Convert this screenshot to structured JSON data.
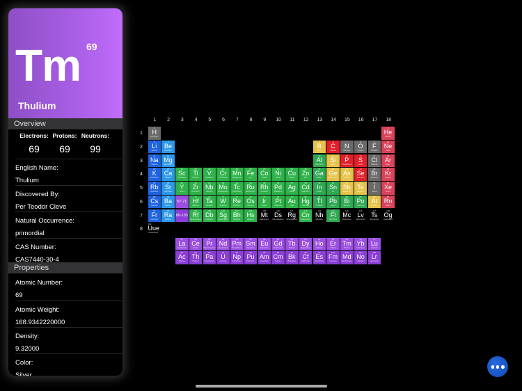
{
  "detail": {
    "symbol": "Tm",
    "atomic_number": "69",
    "name": "Thulium",
    "header_color": "#b061ea",
    "overview_title": "Overview",
    "counts": [
      {
        "label": "Electrons:",
        "value": "69"
      },
      {
        "label": "Protons:",
        "value": "69"
      },
      {
        "label": "Neutrons:",
        "value": "99"
      }
    ],
    "overview_rows": [
      {
        "label": "English Name:",
        "value": "Thulium"
      },
      {
        "label": "Discovered By:",
        "value": "Per Teodor Cleve"
      },
      {
        "label": "Natural Occurrence:",
        "value": "primordial"
      },
      {
        "label": "CAS Number:",
        "value": "CAS7440-30-4"
      }
    ],
    "properties_title": "Properties",
    "property_rows": [
      {
        "label": "Atomic Number:",
        "value": "69"
      },
      {
        "label": "Atomic Weight:",
        "value": "168.9342220000"
      },
      {
        "label": "Density:",
        "value": "9.32000"
      },
      {
        "label": "Color:",
        "value": "Silver"
      }
    ]
  },
  "table": {
    "group_labels": [
      "1",
      "2",
      "3",
      "4",
      "5",
      "6",
      "7",
      "8",
      "9",
      "10",
      "11",
      "12",
      "13",
      "14",
      "15",
      "16",
      "17",
      "18"
    ],
    "period_labels": [
      "1",
      "2",
      "3",
      "4",
      "5",
      "6",
      "7",
      "8"
    ],
    "category_colors": {
      "nonmetal": "#e0202a",
      "noble": "#d9435a",
      "alkali": "#1f63e0",
      "alkaline": "#2d98ea",
      "transition": "#2fb24a",
      "post": "#2fa852",
      "metalloid": "#e6c34a",
      "halogen": "#6a6a6a",
      "hydrogen": "#6a6a6a",
      "lanthanide": "#9b4fe0",
      "actinide": "#8b3fd6",
      "unknown": "#000000"
    },
    "elements": [
      {
        "z": "1",
        "sym": "H",
        "name": "Hydrogen",
        "g": 1,
        "p": 1,
        "cat": "hydrogen"
      },
      {
        "z": "2",
        "sym": "He",
        "name": "Helium",
        "g": 18,
        "p": 1,
        "cat": "noble"
      },
      {
        "z": "3",
        "sym": "Li",
        "name": "Lithium",
        "g": 1,
        "p": 2,
        "cat": "alkali"
      },
      {
        "z": "4",
        "sym": "Be",
        "name": "Beryllium",
        "g": 2,
        "p": 2,
        "cat": "alkaline"
      },
      {
        "z": "5",
        "sym": "B",
        "name": "Boron",
        "g": 13,
        "p": 2,
        "cat": "metalloid"
      },
      {
        "z": "6",
        "sym": "C",
        "name": "Carbon",
        "g": 14,
        "p": 2,
        "cat": "nonmetal"
      },
      {
        "z": "7",
        "sym": "N",
        "name": "Nitrogen",
        "g": 15,
        "p": 2,
        "cat": "halogen"
      },
      {
        "z": "8",
        "sym": "O",
        "name": "Oxygen",
        "g": 16,
        "p": 2,
        "cat": "halogen"
      },
      {
        "z": "9",
        "sym": "F",
        "name": "Fluorine",
        "g": 17,
        "p": 2,
        "cat": "halogen"
      },
      {
        "z": "10",
        "sym": "Ne",
        "name": "Neon",
        "g": 18,
        "p": 2,
        "cat": "noble"
      },
      {
        "z": "11",
        "sym": "Na",
        "name": "Sodium",
        "g": 1,
        "p": 3,
        "cat": "alkali"
      },
      {
        "z": "12",
        "sym": "Mg",
        "name": "Magnesium",
        "g": 2,
        "p": 3,
        "cat": "alkaline"
      },
      {
        "z": "13",
        "sym": "Al",
        "name": "Aluminium",
        "g": 13,
        "p": 3,
        "cat": "post"
      },
      {
        "z": "14",
        "sym": "Si",
        "name": "Silicon",
        "g": 14,
        "p": 3,
        "cat": "metalloid"
      },
      {
        "z": "15",
        "sym": "P",
        "name": "Phosphorus",
        "g": 15,
        "p": 3,
        "cat": "nonmetal"
      },
      {
        "z": "16",
        "sym": "S",
        "name": "Sulfur",
        "g": 16,
        "p": 3,
        "cat": "nonmetal"
      },
      {
        "z": "17",
        "sym": "Cl",
        "name": "Chlorine",
        "g": 17,
        "p": 3,
        "cat": "halogen"
      },
      {
        "z": "18",
        "sym": "Ar",
        "name": "Argon",
        "g": 18,
        "p": 3,
        "cat": "noble"
      },
      {
        "z": "19",
        "sym": "K",
        "name": "Potassium",
        "g": 1,
        "p": 4,
        "cat": "alkali"
      },
      {
        "z": "20",
        "sym": "Ca",
        "name": "Calcium",
        "g": 2,
        "p": 4,
        "cat": "alkaline"
      },
      {
        "z": "21",
        "sym": "Sc",
        "name": "Scandium",
        "g": 3,
        "p": 4,
        "cat": "transition"
      },
      {
        "z": "22",
        "sym": "Ti",
        "name": "Titanium",
        "g": 4,
        "p": 4,
        "cat": "transition"
      },
      {
        "z": "23",
        "sym": "V",
        "name": "Vanadium",
        "g": 5,
        "p": 4,
        "cat": "transition"
      },
      {
        "z": "24",
        "sym": "Cr",
        "name": "Chromium",
        "g": 6,
        "p": 4,
        "cat": "transition"
      },
      {
        "z": "25",
        "sym": "Mn",
        "name": "Manganese",
        "g": 7,
        "p": 4,
        "cat": "transition"
      },
      {
        "z": "26",
        "sym": "Fe",
        "name": "Iron",
        "g": 8,
        "p": 4,
        "cat": "transition"
      },
      {
        "z": "27",
        "sym": "Co",
        "name": "Cobalt",
        "g": 9,
        "p": 4,
        "cat": "transition"
      },
      {
        "z": "28",
        "sym": "Ni",
        "name": "Nickel",
        "g": 10,
        "p": 4,
        "cat": "transition"
      },
      {
        "z": "29",
        "sym": "Cu",
        "name": "Copper",
        "g": 11,
        "p": 4,
        "cat": "transition"
      },
      {
        "z": "30",
        "sym": "Zn",
        "name": "Zinc",
        "g": 12,
        "p": 4,
        "cat": "transition"
      },
      {
        "z": "31",
        "sym": "Ga",
        "name": "Gallium",
        "g": 13,
        "p": 4,
        "cat": "post"
      },
      {
        "z": "32",
        "sym": "Ge",
        "name": "Germanium",
        "g": 14,
        "p": 4,
        "cat": "metalloid"
      },
      {
        "z": "33",
        "sym": "As",
        "name": "Arsenic",
        "g": 15,
        "p": 4,
        "cat": "metalloid"
      },
      {
        "z": "34",
        "sym": "Se",
        "name": "Selenium",
        "g": 16,
        "p": 4,
        "cat": "nonmetal"
      },
      {
        "z": "35",
        "sym": "Br",
        "name": "Bromine",
        "g": 17,
        "p": 4,
        "cat": "halogen"
      },
      {
        "z": "36",
        "sym": "Kr",
        "name": "Krypton",
        "g": 18,
        "p": 4,
        "cat": "noble"
      },
      {
        "z": "37",
        "sym": "Rb",
        "name": "Rubidium",
        "g": 1,
        "p": 5,
        "cat": "alkali"
      },
      {
        "z": "38",
        "sym": "Sr",
        "name": "Strontium",
        "g": 2,
        "p": 5,
        "cat": "alkaline"
      },
      {
        "z": "39",
        "sym": "Y",
        "name": "Yttrium",
        "g": 3,
        "p": 5,
        "cat": "transition"
      },
      {
        "z": "40",
        "sym": "Zr",
        "name": "Zirconium",
        "g": 4,
        "p": 5,
        "cat": "transition"
      },
      {
        "z": "41",
        "sym": "Nb",
        "name": "Niobium",
        "g": 5,
        "p": 5,
        "cat": "transition"
      },
      {
        "z": "42",
        "sym": "Mo",
        "name": "Molybdenum",
        "g": 6,
        "p": 5,
        "cat": "transition"
      },
      {
        "z": "43",
        "sym": "Tc",
        "name": "Technetium",
        "g": 7,
        "p": 5,
        "cat": "transition"
      },
      {
        "z": "44",
        "sym": "Ru",
        "name": "Ruthenium",
        "g": 8,
        "p": 5,
        "cat": "transition"
      },
      {
        "z": "45",
        "sym": "Rh",
        "name": "Rhodium",
        "g": 9,
        "p": 5,
        "cat": "transition"
      },
      {
        "z": "46",
        "sym": "Pd",
        "name": "Palladium",
        "g": 10,
        "p": 5,
        "cat": "transition"
      },
      {
        "z": "47",
        "sym": "Ag",
        "name": "Silver",
        "g": 11,
        "p": 5,
        "cat": "transition"
      },
      {
        "z": "48",
        "sym": "Cd",
        "name": "Cadmium",
        "g": 12,
        "p": 5,
        "cat": "transition"
      },
      {
        "z": "49",
        "sym": "In",
        "name": "Indium",
        "g": 13,
        "p": 5,
        "cat": "post"
      },
      {
        "z": "50",
        "sym": "Sn",
        "name": "Tin",
        "g": 14,
        "p": 5,
        "cat": "post"
      },
      {
        "z": "51",
        "sym": "Sb",
        "name": "Antimony",
        "g": 15,
        "p": 5,
        "cat": "metalloid"
      },
      {
        "z": "52",
        "sym": "Te",
        "name": "Tellurium",
        "g": 16,
        "p": 5,
        "cat": "metalloid"
      },
      {
        "z": "53",
        "sym": "I",
        "name": "Iodine",
        "g": 17,
        "p": 5,
        "cat": "halogen"
      },
      {
        "z": "54",
        "sym": "Xe",
        "name": "Xenon",
        "g": 18,
        "p": 5,
        "cat": "noble"
      },
      {
        "z": "55",
        "sym": "Cs",
        "name": "Caesium",
        "g": 1,
        "p": 6,
        "cat": "alkali"
      },
      {
        "z": "56",
        "sym": "Ba",
        "name": "Barium",
        "g": 2,
        "p": 6,
        "cat": "alkaline"
      },
      {
        "z": "",
        "sym": "57-71",
        "name": "",
        "g": 3,
        "p": 6,
        "cat": "lanthanide",
        "range": true
      },
      {
        "z": "72",
        "sym": "Hf",
        "name": "Hafnium",
        "g": 4,
        "p": 6,
        "cat": "transition"
      },
      {
        "z": "73",
        "sym": "Ta",
        "name": "Tantalum",
        "g": 5,
        "p": 6,
        "cat": "transition"
      },
      {
        "z": "74",
        "sym": "W",
        "name": "Tungsten",
        "g": 6,
        "p": 6,
        "cat": "transition"
      },
      {
        "z": "75",
        "sym": "Re",
        "name": "Rhenium",
        "g": 7,
        "p": 6,
        "cat": "transition"
      },
      {
        "z": "76",
        "sym": "Os",
        "name": "Osmium",
        "g": 8,
        "p": 6,
        "cat": "transition"
      },
      {
        "z": "77",
        "sym": "Ir",
        "name": "Iridium",
        "g": 9,
        "p": 6,
        "cat": "transition"
      },
      {
        "z": "78",
        "sym": "Pt",
        "name": "Platinum",
        "g": 10,
        "p": 6,
        "cat": "transition"
      },
      {
        "z": "79",
        "sym": "Au",
        "name": "Gold",
        "g": 11,
        "p": 6,
        "cat": "transition"
      },
      {
        "z": "80",
        "sym": "Hg",
        "name": "Mercury",
        "g": 12,
        "p": 6,
        "cat": "transition"
      },
      {
        "z": "81",
        "sym": "Tl",
        "name": "Thallium",
        "g": 13,
        "p": 6,
        "cat": "post"
      },
      {
        "z": "82",
        "sym": "Pb",
        "name": "Lead",
        "g": 14,
        "p": 6,
        "cat": "post"
      },
      {
        "z": "83",
        "sym": "Bi",
        "name": "Bismuth",
        "g": 15,
        "p": 6,
        "cat": "post"
      },
      {
        "z": "84",
        "sym": "Po",
        "name": "Polonium",
        "g": 16,
        "p": 6,
        "cat": "post"
      },
      {
        "z": "85",
        "sym": "At",
        "name": "Astatine",
        "g": 17,
        "p": 6,
        "cat": "metalloid"
      },
      {
        "z": "86",
        "sym": "Rn",
        "name": "Radon",
        "g": 18,
        "p": 6,
        "cat": "noble"
      },
      {
        "z": "87",
        "sym": "Fr",
        "name": "Francium",
        "g": 1,
        "p": 7,
        "cat": "alkali"
      },
      {
        "z": "88",
        "sym": "Ra",
        "name": "Radium",
        "g": 2,
        "p": 7,
        "cat": "alkaline"
      },
      {
        "z": "",
        "sym": "89-103",
        "name": "",
        "g": 3,
        "p": 7,
        "cat": "actinide",
        "range": true
      },
      {
        "z": "104",
        "sym": "Rf",
        "name": "Rutherfordium",
        "g": 4,
        "p": 7,
        "cat": "transition"
      },
      {
        "z": "105",
        "sym": "Db",
        "name": "Dubnium",
        "g": 5,
        "p": 7,
        "cat": "transition"
      },
      {
        "z": "106",
        "sym": "Sg",
        "name": "Seaborgium",
        "g": 6,
        "p": 7,
        "cat": "transition"
      },
      {
        "z": "107",
        "sym": "Bh",
        "name": "Bohrium",
        "g": 7,
        "p": 7,
        "cat": "transition"
      },
      {
        "z": "108",
        "sym": "Hs",
        "name": "Hassium",
        "g": 8,
        "p": 7,
        "cat": "transition"
      },
      {
        "z": "109",
        "sym": "Mt",
        "name": "Meitnerium",
        "g": 9,
        "p": 7,
        "cat": "unknown"
      },
      {
        "z": "110",
        "sym": "Ds",
        "name": "Darmstadtium",
        "g": 10,
        "p": 7,
        "cat": "unknown"
      },
      {
        "z": "111",
        "sym": "Rg",
        "name": "Roentgenium",
        "g": 11,
        "p": 7,
        "cat": "unknown"
      },
      {
        "z": "112",
        "sym": "Cn",
        "name": "Copernicium",
        "g": 12,
        "p": 7,
        "cat": "transition"
      },
      {
        "z": "113",
        "sym": "Nh",
        "name": "Nihonium",
        "g": 13,
        "p": 7,
        "cat": "unknown"
      },
      {
        "z": "114",
        "sym": "Fl",
        "name": "Flerovium",
        "g": 14,
        "p": 7,
        "cat": "post"
      },
      {
        "z": "115",
        "sym": "Mc",
        "name": "Moscovium",
        "g": 15,
        "p": 7,
        "cat": "unknown"
      },
      {
        "z": "116",
        "sym": "Lv",
        "name": "Livermorium",
        "g": 16,
        "p": 7,
        "cat": "unknown"
      },
      {
        "z": "117",
        "sym": "Ts",
        "name": "Tennessine",
        "g": 17,
        "p": 7,
        "cat": "unknown"
      },
      {
        "z": "118",
        "sym": "Og",
        "name": "Oganesson",
        "g": 18,
        "p": 7,
        "cat": "unknown"
      },
      {
        "z": "119",
        "sym": "Uue",
        "name": "Ununennium",
        "g": 1,
        "p": 8,
        "cat": "unknown"
      },
      {
        "z": "57",
        "sym": "La",
        "name": "Lanthanum",
        "g": 3,
        "p": 9,
        "cat": "lanthanide"
      },
      {
        "z": "58",
        "sym": "Ce",
        "name": "Cerium",
        "g": 4,
        "p": 9,
        "cat": "lanthanide"
      },
      {
        "z": "59",
        "sym": "Pr",
        "name": "Praseodymium",
        "g": 5,
        "p": 9,
        "cat": "lanthanide"
      },
      {
        "z": "60",
        "sym": "Nd",
        "name": "Neodymium",
        "g": 6,
        "p": 9,
        "cat": "lanthanide"
      },
      {
        "z": "61",
        "sym": "Pm",
        "name": "Promethium",
        "g": 7,
        "p": 9,
        "cat": "lanthanide"
      },
      {
        "z": "62",
        "sym": "Sm",
        "name": "Samarium",
        "g": 8,
        "p": 9,
        "cat": "lanthanide"
      },
      {
        "z": "63",
        "sym": "Eu",
        "name": "Europium",
        "g": 9,
        "p": 9,
        "cat": "lanthanide"
      },
      {
        "z": "64",
        "sym": "Gd",
        "name": "Gadolinium",
        "g": 10,
        "p": 9,
        "cat": "lanthanide"
      },
      {
        "z": "65",
        "sym": "Tb",
        "name": "Terbium",
        "g": 11,
        "p": 9,
        "cat": "lanthanide"
      },
      {
        "z": "66",
        "sym": "Dy",
        "name": "Dysprosium",
        "g": 12,
        "p": 9,
        "cat": "lanthanide"
      },
      {
        "z": "67",
        "sym": "Ho",
        "name": "Holmium",
        "g": 13,
        "p": 9,
        "cat": "lanthanide"
      },
      {
        "z": "68",
        "sym": "Er",
        "name": "Erbium",
        "g": 14,
        "p": 9,
        "cat": "lanthanide"
      },
      {
        "z": "69",
        "sym": "Tm",
        "name": "Thulium",
        "g": 15,
        "p": 9,
        "cat": "lanthanide"
      },
      {
        "z": "70",
        "sym": "Yb",
        "name": "Ytterbium",
        "g": 16,
        "p": 9,
        "cat": "lanthanide"
      },
      {
        "z": "71",
        "sym": "Lu",
        "name": "Lutetium",
        "g": 17,
        "p": 9,
        "cat": "lanthanide"
      },
      {
        "z": "89",
        "sym": "Ac",
        "name": "Actinium",
        "g": 3,
        "p": 10,
        "cat": "actinide"
      },
      {
        "z": "90",
        "sym": "Th",
        "name": "Thorium",
        "g": 4,
        "p": 10,
        "cat": "actinide"
      },
      {
        "z": "91",
        "sym": "Pa",
        "name": "Protactinium",
        "g": 5,
        "p": 10,
        "cat": "actinide"
      },
      {
        "z": "92",
        "sym": "U",
        "name": "Uranium",
        "g": 6,
        "p": 10,
        "cat": "actinide"
      },
      {
        "z": "93",
        "sym": "Np",
        "name": "Neptunium",
        "g": 7,
        "p": 10,
        "cat": "actinide"
      },
      {
        "z": "94",
        "sym": "Pu",
        "name": "Plutonium",
        "g": 8,
        "p": 10,
        "cat": "actinide"
      },
      {
        "z": "95",
        "sym": "Am",
        "name": "Americium",
        "g": 9,
        "p": 10,
        "cat": "actinide"
      },
      {
        "z": "96",
        "sym": "Cm",
        "name": "Curium",
        "g": 10,
        "p": 10,
        "cat": "actinide"
      },
      {
        "z": "97",
        "sym": "Bk",
        "name": "Berkelium",
        "g": 11,
        "p": 10,
        "cat": "actinide"
      },
      {
        "z": "98",
        "sym": "Cf",
        "name": "Californium",
        "g": 12,
        "p": 10,
        "cat": "actinide"
      },
      {
        "z": "99",
        "sym": "Es",
        "name": "Einsteinium",
        "g": 13,
        "p": 10,
        "cat": "actinide"
      },
      {
        "z": "100",
        "sym": "Fm",
        "name": "Fermium",
        "g": 14,
        "p": 10,
        "cat": "actinide"
      },
      {
        "z": "101",
        "sym": "Md",
        "name": "Mendelevium",
        "g": 15,
        "p": 10,
        "cat": "actinide"
      },
      {
        "z": "102",
        "sym": "No",
        "name": "Nobelium",
        "g": 16,
        "p": 10,
        "cat": "actinide"
      },
      {
        "z": "103",
        "sym": "Lr",
        "name": "Lawrencium",
        "g": 17,
        "p": 10,
        "cat": "actinide"
      }
    ]
  },
  "more_button": {
    "icon": "ellipsis-icon",
    "color": "#1a5ad0"
  }
}
